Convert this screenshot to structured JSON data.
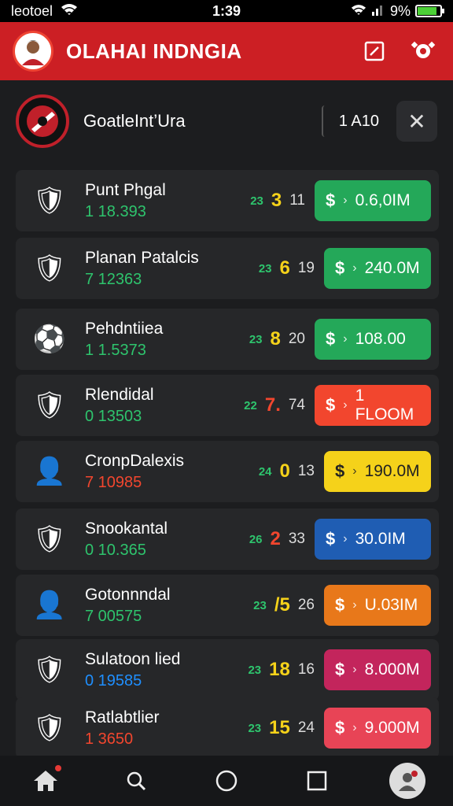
{
  "status_bar": {
    "carrier": "leotoel",
    "time": "1:39",
    "battery": "9%"
  },
  "header": {
    "title": "OLAHAI INDNGIA"
  },
  "team": {
    "name": "GoatleInt’Ura",
    "rank_label": "1 A10"
  },
  "colors": {
    "header_red": "#cc1f24",
    "green": "#24a859",
    "red": "#f2462e",
    "yellow": "#f5d21a",
    "blue": "#1f5db3",
    "orange": "#e8781a",
    "magenta": "#c3255c",
    "pink_red": "#e84456"
  },
  "players": [
    {
      "name": "Punt Phgal",
      "score": "1 18.393",
      "score_color": "#2ec46d",
      "stat_tag": "23",
      "stat_main": "3",
      "stat_main_color": "#f5d21a",
      "stat_sub": "11",
      "value": "0.6,0IM",
      "btn_color": "#24a859",
      "badge": "🛡",
      "value_text_color": "#fff"
    },
    {
      "name": "Planan Patalcis",
      "score": "7 12363",
      "score_color": "#2ec46d",
      "stat_tag": "23",
      "stat_main": "6",
      "stat_main_color": "#f5d21a",
      "stat_sub": "19",
      "value": "240.0M",
      "btn_color": "#24a859",
      "badge": "🛡",
      "value_text_color": "#fff"
    },
    {
      "name": "Pehdntiiea",
      "score": "1 1.5373",
      "score_color": "#2ec46d",
      "stat_tag": "23",
      "stat_main": "8",
      "stat_main_color": "#f5d21a",
      "stat_sub": "20",
      "value": "108.00",
      "btn_color": "#24a859",
      "badge": "⚽",
      "value_text_color": "#fff"
    },
    {
      "name": "Rlendidal",
      "score": "0 13503",
      "score_color": "#2ec46d",
      "stat_tag": "22",
      "stat_main": "7.",
      "stat_main_color": "#f2462e",
      "stat_sub": "74",
      "value": "1 FLOOM",
      "btn_color": "#f2462e",
      "badge": "🛡",
      "value_text_color": "#fff"
    },
    {
      "name": "CronpDalexis",
      "score": "7 10985",
      "score_color": "#f2462e",
      "stat_tag": "24",
      "stat_main": "0",
      "stat_main_color": "#f5d21a",
      "stat_sub": "13",
      "value": "190.0M",
      "btn_color": "#f5d21a",
      "badge": "👤",
      "value_text_color": "#222"
    },
    {
      "name": "Snookantal",
      "score": "0 10.365",
      "score_color": "#2ec46d",
      "stat_tag": "26",
      "stat_main": "2",
      "stat_main_color": "#f2462e",
      "stat_sub": "33",
      "value": "30.0IM",
      "btn_color": "#1f5db3",
      "badge": "🛡",
      "value_text_color": "#fff"
    },
    {
      "name": "Gotonnndal",
      "score": "7 00575",
      "score_color": "#2ec46d",
      "stat_tag": "23",
      "stat_main": "/5",
      "stat_main_color": "#f5d21a",
      "stat_sub": "26",
      "value": "U.03IM",
      "btn_color": "#e8781a",
      "badge": "👤",
      "value_text_color": "#fff"
    },
    {
      "name": "Sulatoon lied",
      "score": "0 19585",
      "score_color": "#1f8fff",
      "stat_tag": "23",
      "stat_main": "18",
      "stat_main_color": "#f5d21a",
      "stat_sub": "16",
      "value": "8.000M",
      "btn_color": "#c3255c",
      "badge": "🛡",
      "value_text_color": "#fff"
    },
    {
      "name": "Ratlabtlier",
      "score": "1 3650",
      "score_color": "#f2462e",
      "stat_tag": "23",
      "stat_main": "15",
      "stat_main_color": "#f5d21a",
      "stat_sub": "24",
      "value": "9.000M",
      "btn_color": "#e84456",
      "badge": "🛡",
      "value_text_color": "#fff"
    }
  ],
  "nav": {
    "home": "home-icon",
    "search": "search-icon",
    "circle": "circle-icon",
    "square": "square-icon",
    "profile": "profile-icon"
  }
}
